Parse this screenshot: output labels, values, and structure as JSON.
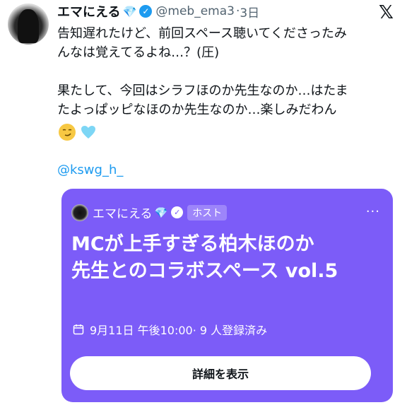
{
  "author": {
    "name": "エマにえる",
    "gem": "💎",
    "verified": "✓",
    "handle": "@meb_ema3",
    "sep": "·",
    "time": "3日"
  },
  "xlogo": "𝕏",
  "tweet": {
    "lines": [
      "告知遅れたけど、前回スペース聴いてくださったみ",
      "んなは覚えてるよね…？(圧)",
      "果たして、今回はシラフほのか先生なのか…はたま",
      "たよっぱッピなほのか先生なのか…楽しみだわん"
    ],
    "emojis": [
      "😏",
      "🩵"
    ],
    "mention": "@kswg_h_"
  },
  "space_card": {
    "host_name": "エマにえる",
    "host_gem": "💎",
    "host_verified": "✓",
    "host_badge": "ホスト",
    "more": "···",
    "title_line1": "MCが上手すぎる柏木ほのか",
    "title_line2": "先生とのコラボスペース vol.5",
    "schedule": "9月11日 午後10:00· 9 人登録済み",
    "button": "詳細を表示",
    "bg_color": "#7c5cf8"
  }
}
